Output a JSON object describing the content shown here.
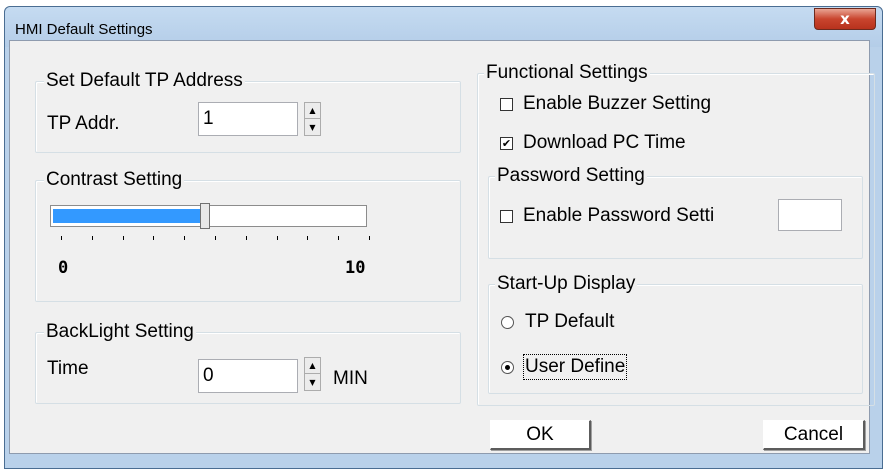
{
  "window": {
    "title": "HMI Default Settings",
    "close_glyph": "x"
  },
  "tp_address": {
    "legend": "Set Default TP Address",
    "label": "TP Addr.",
    "value": "1"
  },
  "contrast": {
    "legend": "Contrast Setting",
    "min_label": "0",
    "max_label": "10",
    "level": 0.5
  },
  "backlight": {
    "legend": "BackLight Setting",
    "label": "Time",
    "value": "0",
    "unit": "MIN"
  },
  "functional": {
    "legend": "Functional Settings",
    "buzzer_label": "Enable Buzzer Setting",
    "buzzer_checked": false,
    "pc_time_label": "Download PC Time",
    "pc_time_checked": true
  },
  "password": {
    "legend": "Password Setting",
    "enable_label": "Enable Password Setti",
    "enable_checked": false,
    "value": ""
  },
  "startup": {
    "legend": "Start-Up Display",
    "option_tp_default": "TP Default",
    "option_user_define": "User Define",
    "selected": "User Define"
  },
  "buttons": {
    "ok": "OK",
    "cancel": "Cancel"
  },
  "spinner": {
    "up_glyph": "▲",
    "down_glyph": "▼"
  },
  "check_glyph": "✔",
  "colors": {
    "titlebar": "#b9d1ea",
    "dialog": "#f0f0f0",
    "slider_fill": "#3399ff",
    "close": "#c9452e"
  }
}
